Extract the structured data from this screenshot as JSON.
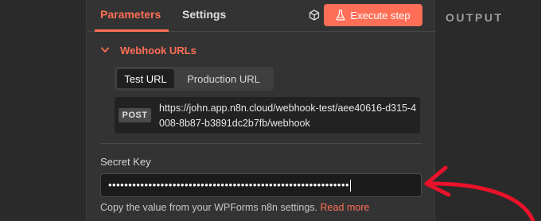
{
  "tabs": {
    "parameters": "Parameters",
    "settings": "Settings"
  },
  "execute_button": {
    "label": "Execute step",
    "icon": "flask-icon"
  },
  "output": {
    "label": "OUTPUT"
  },
  "webhook": {
    "section_title": "Webhook URLs",
    "url_tabs": [
      "Test URL",
      "Production URL"
    ],
    "active_url_tab": "Test URL",
    "method": "POST",
    "url": "https://john.app.n8n.cloud/webhook-test/aee40616-d315-4008-8b87-b3891dc2b7fb/webhook"
  },
  "secret": {
    "label": "Secret Key",
    "value": "••••••••••••••••••••••••••••••••••••••••••••••••••••••••••••",
    "hint": "Copy the value from your WPForms n8n settings.",
    "hint_link": "Read more"
  },
  "colors": {
    "accent": "#ff6e56",
    "panel": "#333333",
    "arrow": "#e8132a"
  }
}
